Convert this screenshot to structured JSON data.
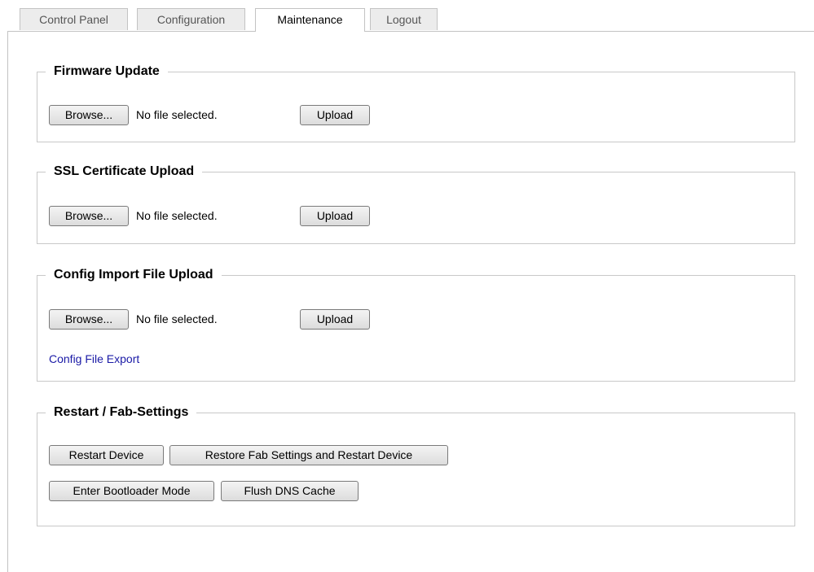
{
  "tabs": [
    {
      "label": "Control Panel",
      "active": false
    },
    {
      "label": "Configuration",
      "active": false
    },
    {
      "label": "Maintenance",
      "active": true
    },
    {
      "label": "Logout",
      "active": false
    }
  ],
  "firmware": {
    "title": "Firmware Update",
    "browse_label": "Browse...",
    "file_status": "No file selected.",
    "upload_label": "Upload"
  },
  "ssl": {
    "title": "SSL Certificate Upload",
    "browse_label": "Browse...",
    "file_status": "No file selected.",
    "upload_label": "Upload"
  },
  "config_import": {
    "title": "Config Import File Upload",
    "browse_label": "Browse...",
    "file_status": "No file selected.",
    "upload_label": "Upload",
    "export_link": "Config File Export"
  },
  "restart": {
    "title": "Restart / Fab-Settings",
    "restart_label": "Restart Device",
    "restore_label": "Restore Fab Settings and Restart Device",
    "bootloader_label": "Enter Bootloader Mode",
    "flush_dns_label": "Flush DNS Cache"
  },
  "colors": {
    "link": "#1a1aa6",
    "border": "#c8c8c8",
    "tab_inactive": "#ececec"
  }
}
